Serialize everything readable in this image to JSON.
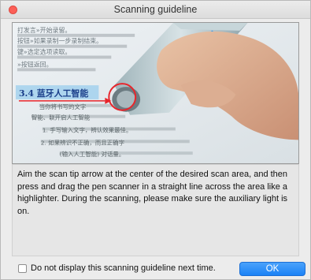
{
  "window": {
    "title": "Scanning guideline"
  },
  "illustration": {
    "text_lines": [
      "打发言»开始录留。",
      "按钮»如果录制一步录制结束。",
      "键»选定选项读取。",
      "»按钮返回。"
    ],
    "highlight_heading": "3.4 蓝牙人工智能",
    "body_lines": [
      "当你将书写的文字",
      "智能、联开启人工智能",
      "1. 手写输入文字，辨认效果最佳。",
      "2. 如果辨识不正确，而且正确字",
      "(输入人工智能) 对话量。"
    ]
  },
  "description": "Aim the scan tip arrow at the center of the desired scan area, and then press and drag the pen scanner in a straight line across the area like a highlighter. During the scanning, please make sure the auxiliary  light is on.",
  "checkbox": {
    "label": "Do not display this scanning guideline next time.",
    "checked": false
  },
  "ok_button": {
    "label": "OK"
  },
  "colors": {
    "accent": "#1a82f6",
    "close": "#fc5f57",
    "arrow": "#e8252b"
  }
}
